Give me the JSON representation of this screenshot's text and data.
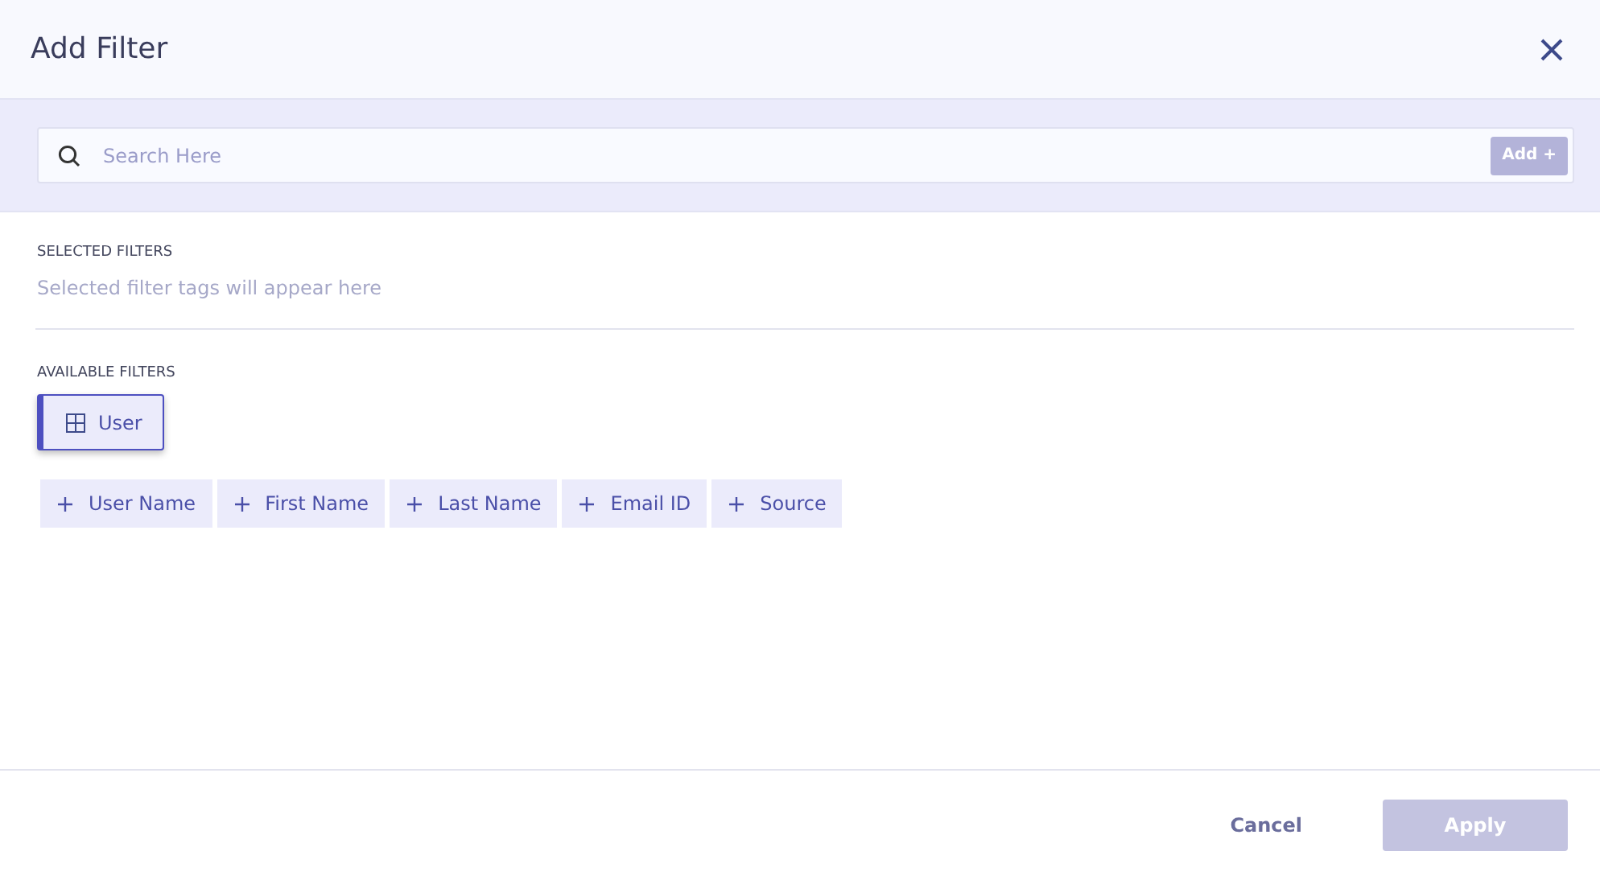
{
  "dialog": {
    "title": "Add Filter"
  },
  "search": {
    "placeholder": "Search Here",
    "add_button": {
      "label": "Add +",
      "disabled": true
    }
  },
  "selected_filters": {
    "heading": "SELECTED FILTERS",
    "empty_text": "Selected filter tags will appear here"
  },
  "available_filters": {
    "heading": "AVAILABLE FILTERS",
    "categories": [
      {
        "label": "User",
        "selected": true
      }
    ],
    "fields": [
      "User Name",
      "First Name",
      "Last Name",
      "Email ID",
      "Source"
    ]
  },
  "footer": {
    "cancel": "Cancel",
    "apply": {
      "label": "Apply",
      "disabled": true
    }
  }
}
